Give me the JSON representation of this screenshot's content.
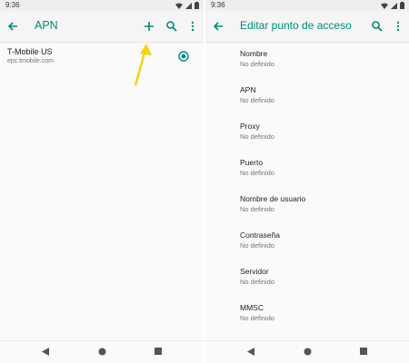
{
  "left": {
    "status_time": "9:36",
    "title": "APN",
    "apn_name": "T-Mobile US",
    "apn_address": "epc.tmobile.com"
  },
  "right": {
    "status_time": "9:36",
    "title": "Editar punto de acceso",
    "fields": [
      {
        "label": "Nombre",
        "value": "No definido"
      },
      {
        "label": "APN",
        "value": "No definido"
      },
      {
        "label": "Proxy",
        "value": "No definido"
      },
      {
        "label": "Puerto",
        "value": "No definido"
      },
      {
        "label": "Nombre de usuario",
        "value": "No definido"
      },
      {
        "label": "Contraseña",
        "value": "No definido"
      },
      {
        "label": "Servidor",
        "value": "No definido"
      },
      {
        "label": "MMSC",
        "value": "No definido"
      }
    ]
  },
  "colors": {
    "accent": "#00897b",
    "annotation_arrow": "#f5d312"
  },
  "icons": [
    "back-arrow-icon",
    "add-icon",
    "search-icon",
    "more-vert-icon",
    "radio-selected-icon",
    "nav-back-icon",
    "nav-home-icon",
    "nav-recents-icon",
    "wifi-icon",
    "signal-icon",
    "battery-icon"
  ]
}
